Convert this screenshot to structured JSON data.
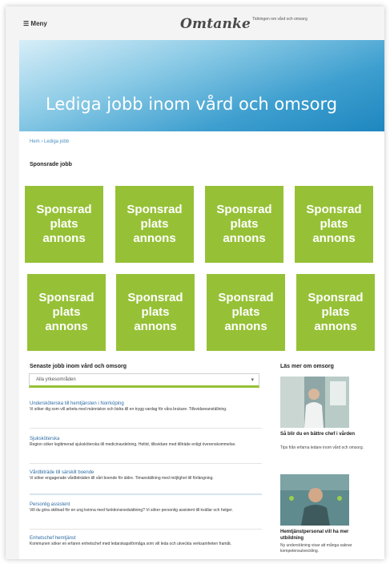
{
  "header": {
    "menu_label": "Meny",
    "logo": "Omtanke",
    "tagline": "Tidningen om vård och omsorg"
  },
  "hero": {
    "title": "Lediga jobb inom vård och omsorg"
  },
  "breadcrumb": "Hem › Lediga jobb",
  "sponsored": {
    "heading": "Sponsrade jobb",
    "tiles": [
      "Sponsrad plats annons",
      "Sponsrad plats annons",
      "Sponsrad plats annons",
      "Sponsrad plats annons",
      "Sponsrad plats annons",
      "Sponsrad plats annons",
      "Sponsrad plats annons",
      "Sponsrad plats annons"
    ]
  },
  "jobs": {
    "heading": "Senaste jobb inom vård och omsorg",
    "filter": {
      "selected": "Alla yrkesområden"
    },
    "items": [
      {
        "title": "Undersköterska till hemtjänsten i Norrköping",
        "desc": "Vi söker dig som vill arbeta med människor och bidra till en trygg vardag för våra brukare. Tillsvidareanställning."
      },
      {
        "title": "Sjuksköterska",
        "desc": "Region söker legitimerad sjuksköterska till medicinavdelning. Heltid, tillsvidare med tillträde enligt överenskommelse."
      },
      {
        "title": "Vårdbiträde till särskilt boende",
        "desc": "Vi söker engagerade vårdbiträden till vårt boende för äldre. Timanställning med möjlighet till förlängning."
      },
      {
        "title": "Personlig assistent",
        "desc": "Vill du göra skillnad för en ung kvinna med funktionsnedsättning? Vi söker personlig assistent till kvällar och helger."
      },
      {
        "title": "Enhetschef hemtjänst",
        "desc": "Kommunen söker en erfaren enhetschef med ledarskapsförmåga som vill leda och utveckla verksamheten framåt."
      }
    ]
  },
  "sidebar": {
    "heading": "Läs mer om omsorg",
    "articles": [
      {
        "title": "Så blir du en bättre chef i vården",
        "desc": "Tips från erfarna ledare inom vård och omsorg."
      },
      {
        "title": "Hemtjänstpersonal vill ha mer utbildning",
        "desc": "Ny undersökning visar att många saknar kompetensutveckling."
      }
    ]
  }
}
